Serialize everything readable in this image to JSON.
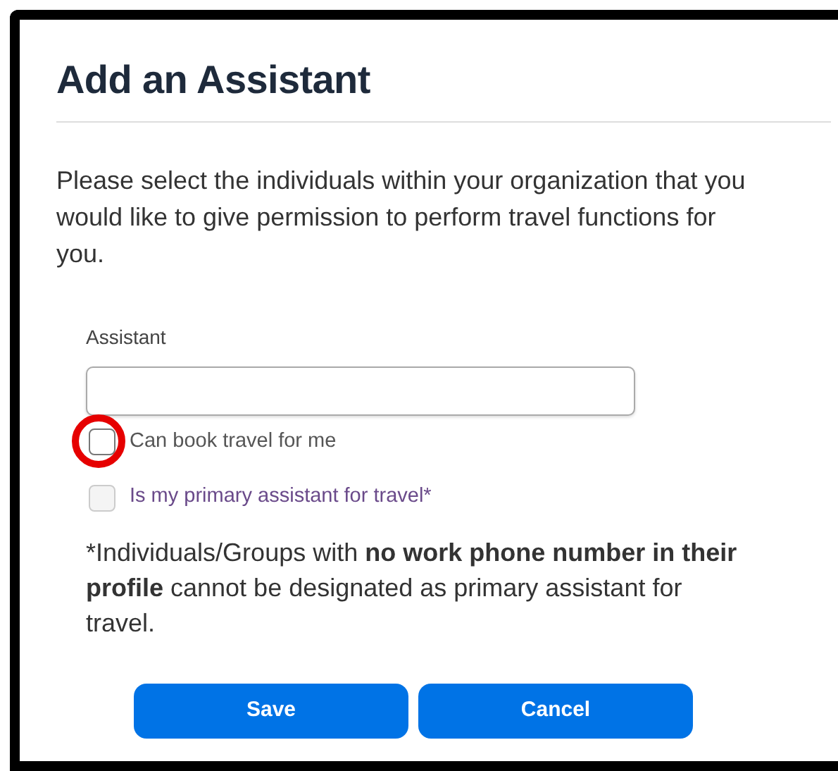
{
  "dialog": {
    "title": "Add an Assistant",
    "intro": "Please select the individuals within your organization that you would like to give permission to perform travel functions for you.",
    "field": {
      "label": "Assistant"
    },
    "checkboxes": [
      {
        "label": "Can book travel for me",
        "checked": false,
        "disabled": false,
        "circled": true
      },
      {
        "label": "Is my primary assistant for travel*",
        "checked": false,
        "disabled": true,
        "circled": false
      }
    ],
    "note": "*Individuals/Groups with **no work phone number in their profile** cannot be designated as primary assistant for travel.",
    "buttons": [
      "Save",
      "Cancel"
    ]
  }
}
